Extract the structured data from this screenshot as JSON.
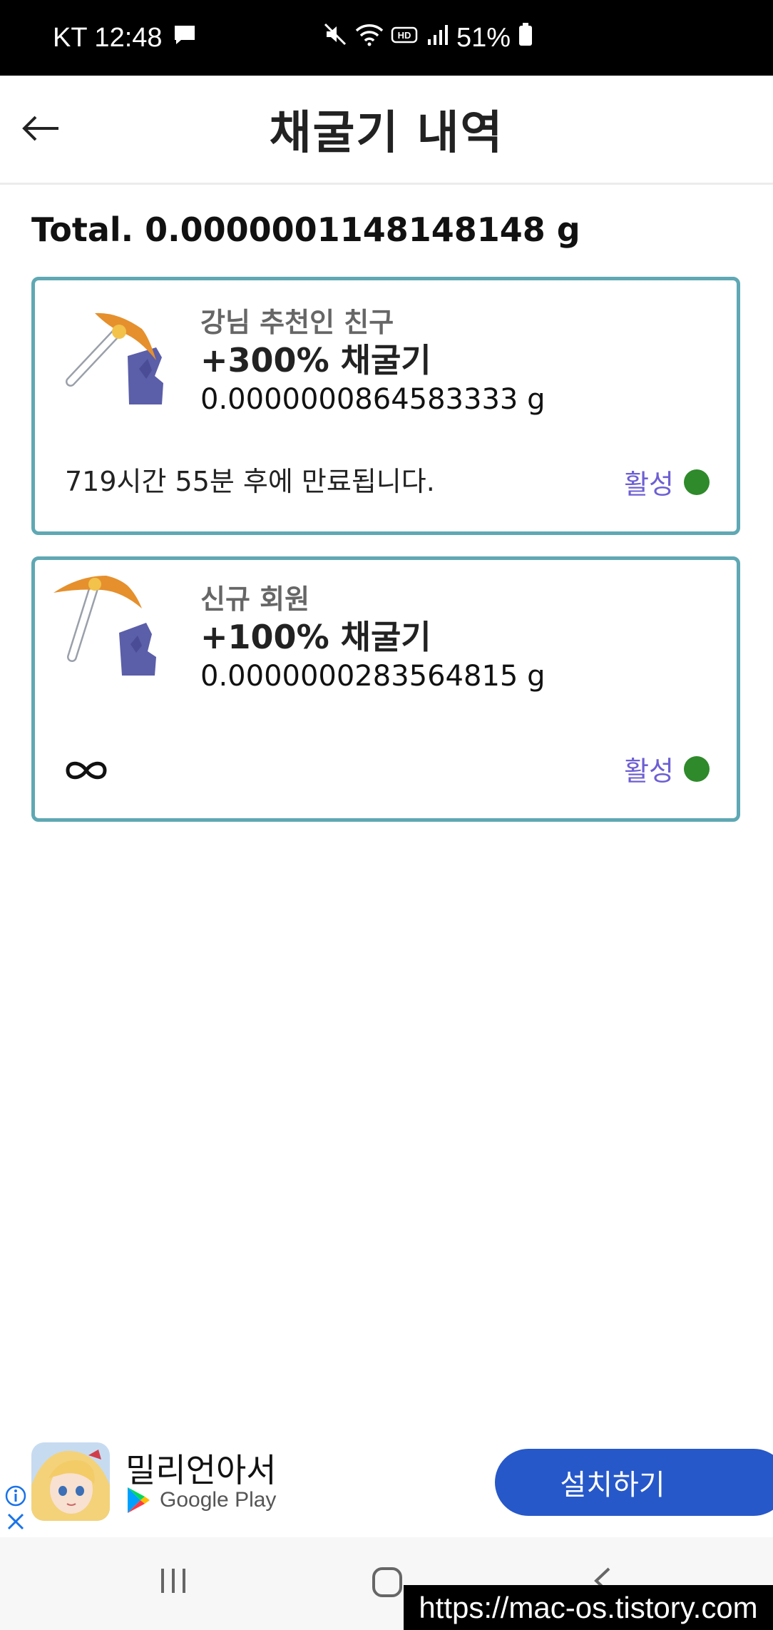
{
  "status_bar": {
    "carrier_time": "KT 12:48",
    "battery": "51%",
    "icons": [
      "message-icon",
      "mute-icon",
      "wifi-icon",
      "hd-icon",
      "signal-icon",
      "battery-icon"
    ]
  },
  "header": {
    "title": "채굴기 내역",
    "back_icon": "arrow-left-icon"
  },
  "total": "Total. 0.0000001148148148 g",
  "cards": [
    {
      "source": "강님 추천인 친구",
      "boost": "+300% 채굴기",
      "amount": "0.0000000864583333 g",
      "expire": "719시간 55분 후에 만료됩니다.",
      "status": "활성",
      "icon": "pickaxe-icon"
    },
    {
      "source": "신규 회원",
      "boost": "+100% 채굴기",
      "amount": "0.0000000283564815 g",
      "expire_icon": "infinity-icon",
      "status": "활성",
      "icon": "pickaxe-icon"
    }
  ],
  "ad": {
    "title": "밀리언아서",
    "store": "Google Play",
    "install_label": "설치하기"
  },
  "watermark": "https://mac-os.tistory.com",
  "colors": {
    "card_border": "#5fa8b4",
    "status_label": "#6d5fd3",
    "status_dot": "#2e8a2a",
    "install_button": "#2658c9"
  }
}
